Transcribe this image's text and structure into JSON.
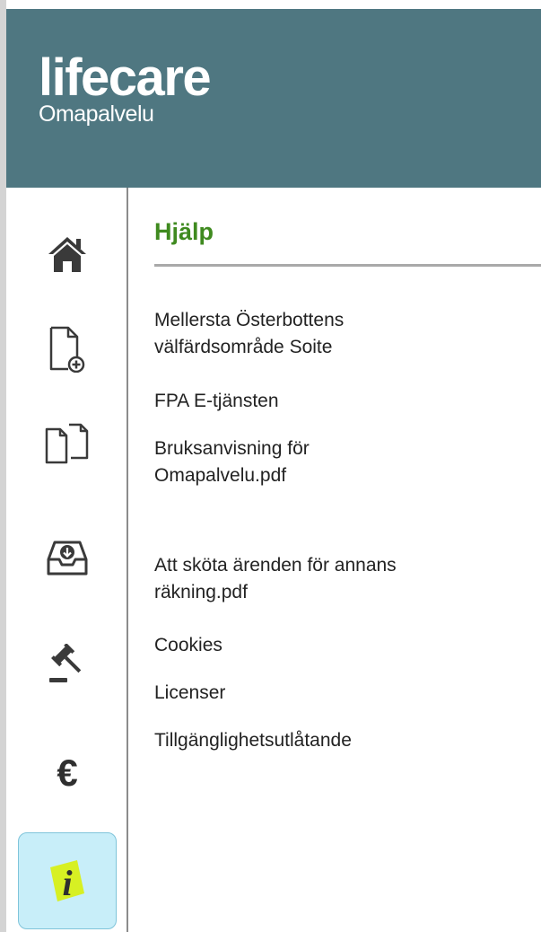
{
  "header": {
    "logo_main": "lifecare",
    "logo_sub": "Omapalvelu"
  },
  "sidebar": {
    "items": [
      {
        "icon": "home-icon"
      },
      {
        "icon": "new-document-icon"
      },
      {
        "icon": "documents-icon"
      },
      {
        "icon": "inbox-icon"
      },
      {
        "icon": "gavel-icon"
      },
      {
        "icon": "euro-icon"
      },
      {
        "icon": "info-icon",
        "active": true
      }
    ]
  },
  "main": {
    "title": "Hjälp",
    "links": [
      {
        "line1": "Mellersta Österbottens",
        "line2": "välfärdsområde Soite"
      },
      {
        "line1": "FPA E-tjänsten"
      },
      {
        "line1": "Bruksanvisning för",
        "line2": "Omapalvelu.pdf"
      },
      {
        "line1": "Att sköta ärenden för annans",
        "line2": "räkning.pdf"
      },
      {
        "line1": "Cookies"
      },
      {
        "line1": "Licenser"
      },
      {
        "line1": "Tillgänglighetsutlåtande"
      }
    ]
  },
  "colors": {
    "header_bg": "#4f7781",
    "title_green": "#3f8a1f",
    "active_item_bg": "#c8eef9",
    "info_highlight": "#d7f023"
  }
}
